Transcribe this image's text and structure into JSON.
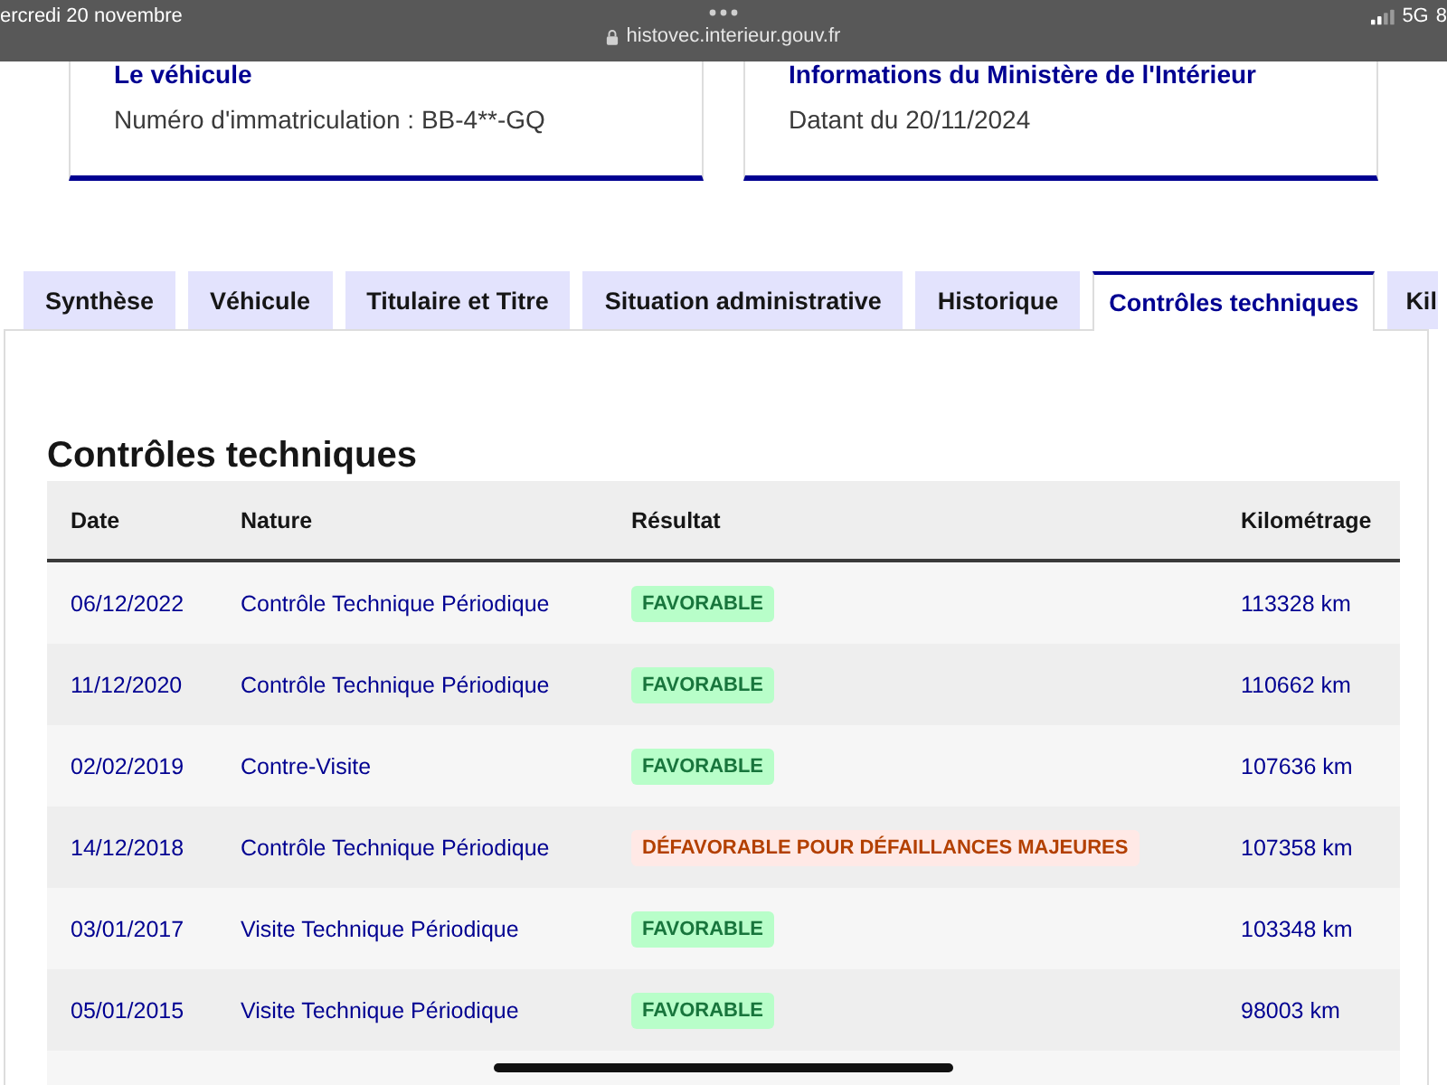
{
  "status_bar": {
    "date": "ercredi 20 novembre",
    "url": "histovec.interieur.gouv.fr",
    "network": "5G",
    "battery": "8"
  },
  "cards": [
    {
      "title": "Le véhicule",
      "text": "Numéro d'immatriculation : BB-4**-GQ"
    },
    {
      "title": "Informations du Ministère de l'Intérieur",
      "text": "Datant du 20/11/2024"
    }
  ],
  "tabs": [
    {
      "label": "Synthèse",
      "selected": false
    },
    {
      "label": "Véhicule",
      "selected": false
    },
    {
      "label": "Titulaire et Titre",
      "selected": false
    },
    {
      "label": "Situation administrative",
      "selected": false
    },
    {
      "label": "Historique",
      "selected": false
    },
    {
      "label": "Contrôles techniques",
      "selected": true
    },
    {
      "label": "Kil",
      "selected": false
    }
  ],
  "section": {
    "title": "Contrôles techniques",
    "table": {
      "columns": [
        "Date",
        "Nature",
        "Résultat",
        "Kilométrage"
      ],
      "rows": [
        {
          "date": "06/12/2022",
          "nature": "Contrôle Technique Périodique",
          "result": {
            "text": "FAVORABLE",
            "kind": "favorable"
          },
          "mileage": "113328 km"
        },
        {
          "date": "11/12/2020",
          "nature": "Contrôle Technique Périodique",
          "result": {
            "text": "FAVORABLE",
            "kind": "favorable"
          },
          "mileage": "110662 km"
        },
        {
          "date": "02/02/2019",
          "nature": "Contre-Visite",
          "result": {
            "text": "FAVORABLE",
            "kind": "favorable"
          },
          "mileage": "107636 km"
        },
        {
          "date": "14/12/2018",
          "nature": "Contrôle Technique Périodique",
          "result": {
            "text": "DÉFAVORABLE POUR DÉFAILLANCES MAJEURES",
            "kind": "unfavorable"
          },
          "mileage": "107358 km"
        },
        {
          "date": "03/01/2017",
          "nature": "Visite Technique Périodique",
          "result": {
            "text": "FAVORABLE",
            "kind": "favorable"
          },
          "mileage": "103348 km"
        },
        {
          "date": "05/01/2015",
          "nature": "Visite Technique Périodique",
          "result": {
            "text": "FAVORABLE",
            "kind": "favorable"
          },
          "mileage": "98003 km"
        }
      ]
    }
  }
}
